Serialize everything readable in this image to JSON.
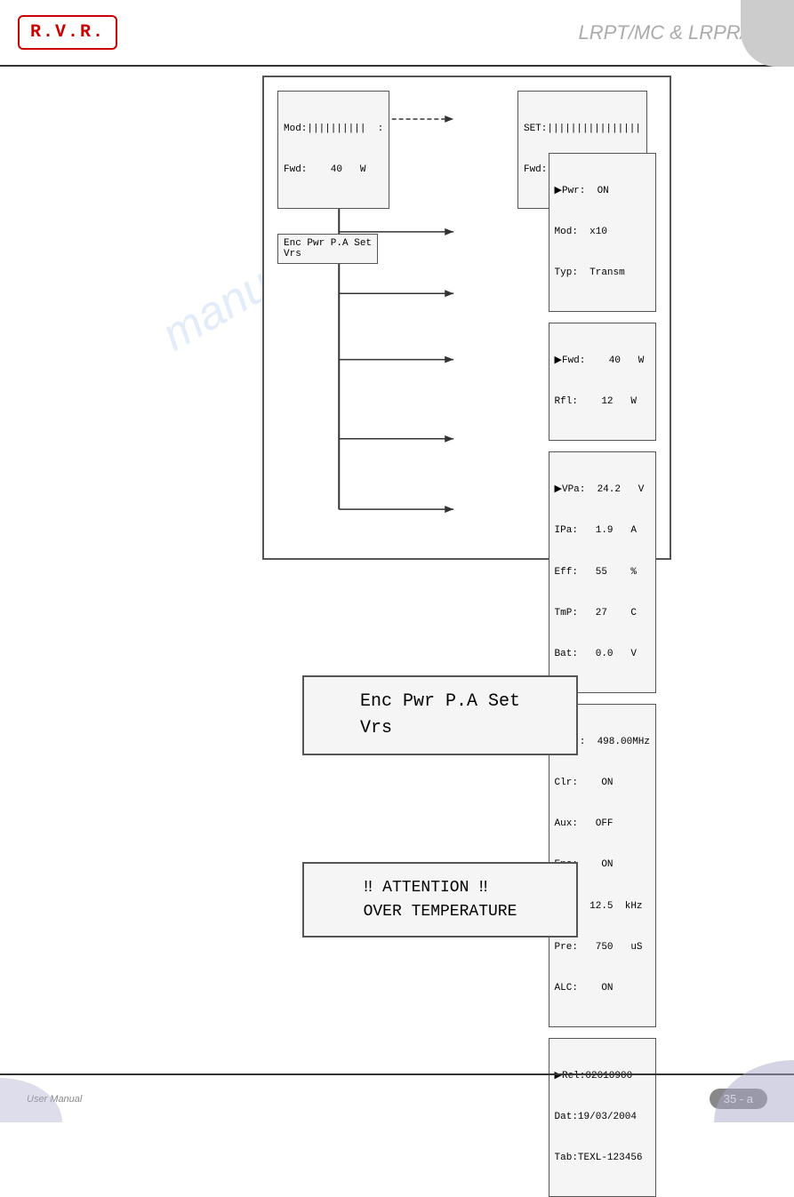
{
  "header": {
    "logo": "R.V.R.",
    "title": "LRPT/MC & LRPR/MC"
  },
  "footer": {
    "left_label": "User Manual",
    "right_label": "35 - a"
  },
  "diagram": {
    "mod_box": {
      "line1": "Mod:||||||||||  :",
      "line2": "Fwd:    40   W"
    },
    "set_box": {
      "line1": "SET:||||||||||||||||",
      "line2": "Fwd:   40   W"
    },
    "enc_box": {
      "line1": "Enc Pwr P.A Set",
      "line2": "Vrs"
    },
    "panel1": {
      "line1": "▶Pwr:  ON",
      "line2": "Mod:  x10",
      "line3": "Typ:  Transm"
    },
    "panel2": {
      "line1": "▶Fwd:    40   W",
      "line2": "Rfl:    12   W"
    },
    "panel3": {
      "line1": "▶VPa:  24.2   V",
      "line2": "IPa:   1.9   A",
      "line3": "Eff:   55    %",
      "line4": "TmP:   27    C",
      "line5": "Bat:   0.0   V"
    },
    "panel4": {
      "line1": "▶F1 :  498.00MHz",
      "line2": "Clr:    ON",
      "line3": "Aux:   OFF",
      "line4": "Enc:    ON",
      "line5": "PB :  12.5  kHz",
      "line6": "Pre:   750   uS",
      "line7": "ALC:    ON"
    },
    "panel5": {
      "line1": "▶Rel:02010900",
      "line2": "Dat:19/03/2004",
      "line3": "Tab:TEXL-123456"
    }
  },
  "menu_display": {
    "line1": "Enc Pwr P.A Set",
    "line2": "Vrs"
  },
  "attention_display": {
    "line1": "‼ ATTENTION ‼",
    "line2": "OVER TEMPERATURE"
  },
  "watermark": "manualshive.com"
}
